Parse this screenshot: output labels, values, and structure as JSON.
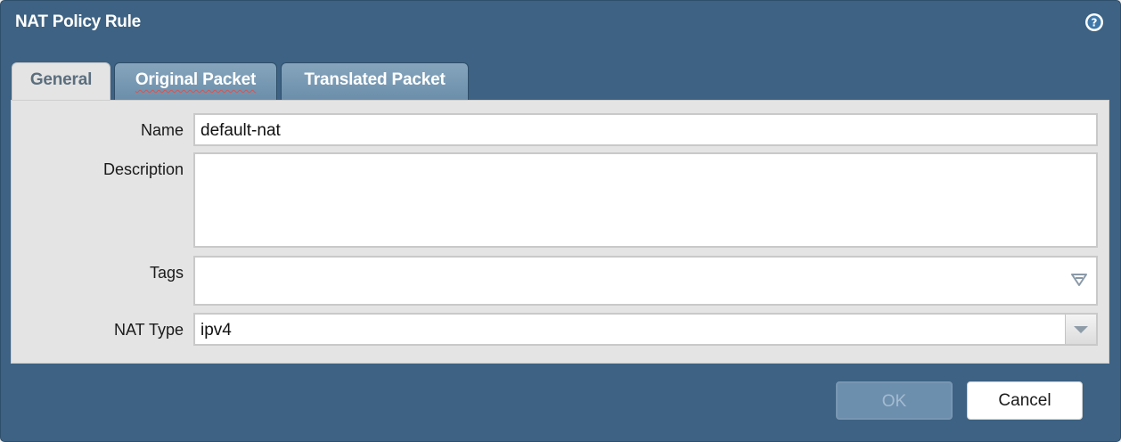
{
  "dialog": {
    "title": "NAT Policy Rule",
    "help_icon": "question-circle-icon"
  },
  "tabs": [
    {
      "label": "General",
      "active": true
    },
    {
      "label": "Original Packet",
      "active": false
    },
    {
      "label": "Translated Packet",
      "active": false
    }
  ],
  "form": {
    "name_label": "Name",
    "name_value": "default-nat",
    "description_label": "Description",
    "description_value": "",
    "tags_label": "Tags",
    "tags_value": "",
    "nat_type_label": "NAT Type",
    "nat_type_value": "ipv4"
  },
  "buttons": {
    "ok_label": "OK",
    "ok_enabled": false,
    "cancel_label": "Cancel"
  },
  "colors": {
    "dialog_background": "#3d6283",
    "panel_background": "#e4e4e4",
    "inactive_tab": "#7a9ab4"
  }
}
